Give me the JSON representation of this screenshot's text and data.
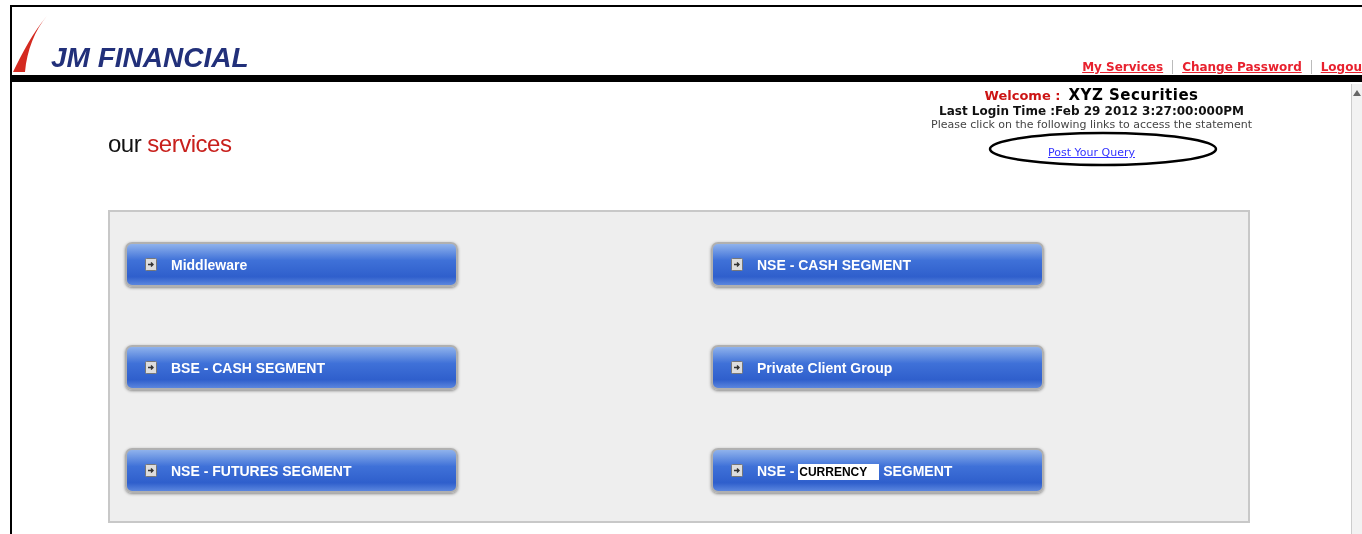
{
  "header": {
    "logo": "JM FINANCIAL",
    "nav_links": [
      {
        "label": "My Services"
      },
      {
        "label": "Change Password"
      },
      {
        "label": "Logou"
      }
    ]
  },
  "welcome": {
    "label": "Welcome :",
    "name": "XYZ Securities",
    "last_login": "Last Login Time :Feb 29 2012 3:27:00:000PM",
    "instruction": "Please click on the following links to access the statement",
    "query_link": "Post Your Query",
    "query_link_circled": true
  },
  "heading": {
    "plain": "our",
    "accent": "services"
  },
  "services": [
    {
      "parts": [
        {
          "text": "Middleware",
          "highlighted": false
        }
      ]
    },
    {
      "parts": [
        {
          "text": "NSE - CASH SEGMENT",
          "highlighted": false
        }
      ]
    },
    {
      "parts": [
        {
          "text": "BSE - CASH SEGMENT",
          "highlighted": false
        }
      ]
    },
    {
      "parts": [
        {
          "text": "Private Client Group",
          "highlighted": false
        }
      ]
    },
    {
      "parts": [
        {
          "text": "NSE - FUTURES SEGMENT",
          "highlighted": false
        }
      ]
    },
    {
      "parts": [
        {
          "text": "NSE -",
          "highlighted": false
        },
        {
          "text": "CURRENCY",
          "highlighted": true
        },
        {
          "text": "SEGMENT",
          "highlighted": false
        }
      ]
    }
  ]
}
